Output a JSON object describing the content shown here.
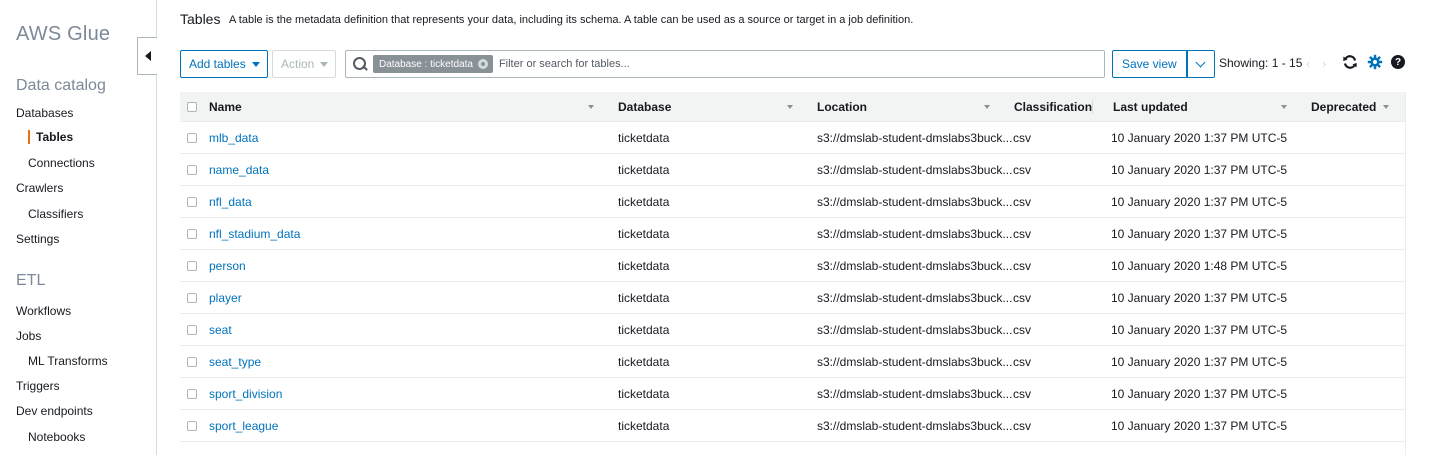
{
  "sidebar": {
    "brand": "AWS Glue",
    "sections": [
      {
        "title": "Data catalog"
      },
      {
        "title": "ETL"
      }
    ],
    "items": [
      {
        "label": "Databases"
      },
      {
        "label": "Tables"
      },
      {
        "label": "Connections"
      },
      {
        "label": "Crawlers"
      },
      {
        "label": "Classifiers"
      },
      {
        "label": "Settings"
      },
      {
        "label": "Workflows"
      },
      {
        "label": "Jobs"
      },
      {
        "label": "ML Transforms"
      },
      {
        "label": "Triggers"
      },
      {
        "label": "Dev endpoints"
      },
      {
        "label": "Notebooks"
      }
    ]
  },
  "header": {
    "title": "Tables",
    "description": "A table is the metadata definition that represents your data, including its schema. A table can be used as a source or target in a job definition."
  },
  "toolbar": {
    "add_tables": "Add tables",
    "action": "Action",
    "filter_chip": "Database : ticketdata",
    "search_placeholder": "Filter or search for tables...",
    "save_view": "Save view",
    "showing": "Showing: 1 - 15"
  },
  "table": {
    "headers": {
      "name": "Name",
      "database": "Database",
      "location": "Location",
      "classification": "Classification",
      "last_updated": "Last updated",
      "deprecated": "Deprecated"
    },
    "rows": [
      {
        "name": "mlb_data",
        "database": "ticketdata",
        "location": "s3://dmslab-student-dmslabs3buck...",
        "classification": "csv",
        "last_updated": "10 January 2020 1:37 PM UTC-5",
        "deprecated": ""
      },
      {
        "name": "name_data",
        "database": "ticketdata",
        "location": "s3://dmslab-student-dmslabs3buck...",
        "classification": "csv",
        "last_updated": "10 January 2020 1:37 PM UTC-5",
        "deprecated": ""
      },
      {
        "name": "nfl_data",
        "database": "ticketdata",
        "location": "s3://dmslab-student-dmslabs3buck...",
        "classification": "csv",
        "last_updated": "10 January 2020 1:37 PM UTC-5",
        "deprecated": ""
      },
      {
        "name": "nfl_stadium_data",
        "database": "ticketdata",
        "location": "s3://dmslab-student-dmslabs3buck...",
        "classification": "csv",
        "last_updated": "10 January 2020 1:37 PM UTC-5",
        "deprecated": ""
      },
      {
        "name": "person",
        "database": "ticketdata",
        "location": "s3://dmslab-student-dmslabs3buck...",
        "classification": "csv",
        "last_updated": "10 January 2020 1:48 PM UTC-5",
        "deprecated": ""
      },
      {
        "name": "player",
        "database": "ticketdata",
        "location": "s3://dmslab-student-dmslabs3buck...",
        "classification": "csv",
        "last_updated": "10 January 2020 1:37 PM UTC-5",
        "deprecated": ""
      },
      {
        "name": "seat",
        "database": "ticketdata",
        "location": "s3://dmslab-student-dmslabs3buck...",
        "classification": "csv",
        "last_updated": "10 January 2020 1:37 PM UTC-5",
        "deprecated": ""
      },
      {
        "name": "seat_type",
        "database": "ticketdata",
        "location": "s3://dmslab-student-dmslabs3buck...",
        "classification": "csv",
        "last_updated": "10 January 2020 1:37 PM UTC-5",
        "deprecated": ""
      },
      {
        "name": "sport_division",
        "database": "ticketdata",
        "location": "s3://dmslab-student-dmslabs3buck...",
        "classification": "csv",
        "last_updated": "10 January 2020 1:37 PM UTC-5",
        "deprecated": ""
      },
      {
        "name": "sport_league",
        "database": "ticketdata",
        "location": "s3://dmslab-student-dmslabs3buck...",
        "classification": "csv",
        "last_updated": "10 January 2020 1:37 PM UTC-5",
        "deprecated": ""
      }
    ]
  },
  "colors": {
    "accent": "#0073bb",
    "active_marker": "#ec7211",
    "muted_text": "#7d8998",
    "header_bg": "#f2f3f3"
  },
  "icons": [
    "collapse-sidebar-icon",
    "search-icon",
    "remove-filter-icon",
    "chevron-down-icon",
    "previous-page-icon",
    "next-page-icon",
    "refresh-icon",
    "settings-gear-icon",
    "help-icon"
  ]
}
